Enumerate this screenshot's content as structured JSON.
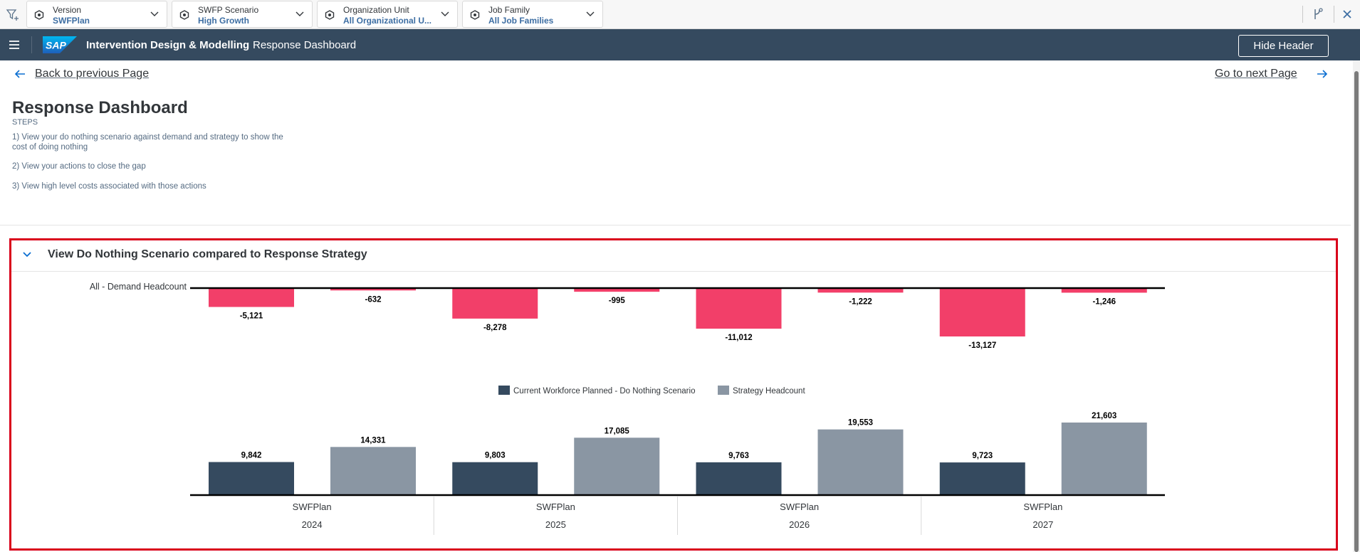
{
  "filters": [
    {
      "label": "Version",
      "value": "SWFPlan"
    },
    {
      "label": "SWFP Scenario",
      "value": "High Growth"
    },
    {
      "label": "Organization Unit",
      "value": "All Organizational U..."
    },
    {
      "label": "Job Family",
      "value": "All Job Families"
    }
  ],
  "shell": {
    "logo_text": "SAP",
    "app_title": "Intervention Design & Modelling",
    "page": "Response Dashboard",
    "hide_header": "Hide Header"
  },
  "nav": {
    "back": "Back to previous Page",
    "next": "Go to next Page"
  },
  "dashboard": {
    "title": "Response Dashboard",
    "steps_label": "STEPS",
    "steps": [
      "1) View your do nothing scenario against demand and strategy to show the cost of doing nothing",
      "2) View your actions to close the gap",
      "3) View high level costs associated with those actions"
    ]
  },
  "panel": {
    "title": "View Do Nothing Scenario compared to Response Strategy"
  },
  "colors": {
    "do_nothing": "#354a5f",
    "strategy": "#8a96a3",
    "gap": "#f23f69",
    "highlight_border": "#d9001b"
  },
  "icons": [
    "filter-add-icon",
    "cube-icon",
    "chevron-down-icon",
    "menu-icon",
    "arrow-left-icon",
    "arrow-right-icon",
    "share-icon",
    "close-icon"
  ],
  "chart_data": [
    {
      "type": "bar",
      "row_label": "All - Demand Headcount",
      "categories": [
        "2024",
        "2025",
        "2026",
        "2027"
      ],
      "series": [
        {
          "name": "Current Workforce Planned - Do Nothing Scenario",
          "values": [
            -5121,
            -8278,
            -11012,
            -13127
          ]
        },
        {
          "name": "Strategy Headcount",
          "values": [
            -632,
            -995,
            -1222,
            -1246
          ]
        }
      ],
      "data_labels": [
        [
          "-5,121",
          "-632"
        ],
        [
          "-8,278",
          "-995"
        ],
        [
          "-11,012",
          "-1,222"
        ],
        [
          "-13,127",
          "-1,246"
        ]
      ]
    },
    {
      "type": "bar",
      "categories": [
        "2024",
        "2025",
        "2026",
        "2027"
      ],
      "version_labels": [
        "SWFPlan",
        "SWFPlan",
        "SWFPlan",
        "SWFPlan"
      ],
      "legend": [
        "Current Workforce Planned - Do Nothing Scenario",
        "Strategy Headcount"
      ],
      "legend_position": "top-center",
      "series": [
        {
          "name": "Current Workforce Planned - Do Nothing Scenario",
          "values": [
            9842,
            9803,
            9763,
            9723
          ]
        },
        {
          "name": "Strategy Headcount",
          "values": [
            14331,
            17085,
            19553,
            21603
          ]
        }
      ],
      "data_labels": [
        [
          "9,842",
          "14,331"
        ],
        [
          "9,803",
          "17,085"
        ],
        [
          "9,763",
          "19,553"
        ],
        [
          "9,723",
          "21,603"
        ]
      ]
    }
  ]
}
